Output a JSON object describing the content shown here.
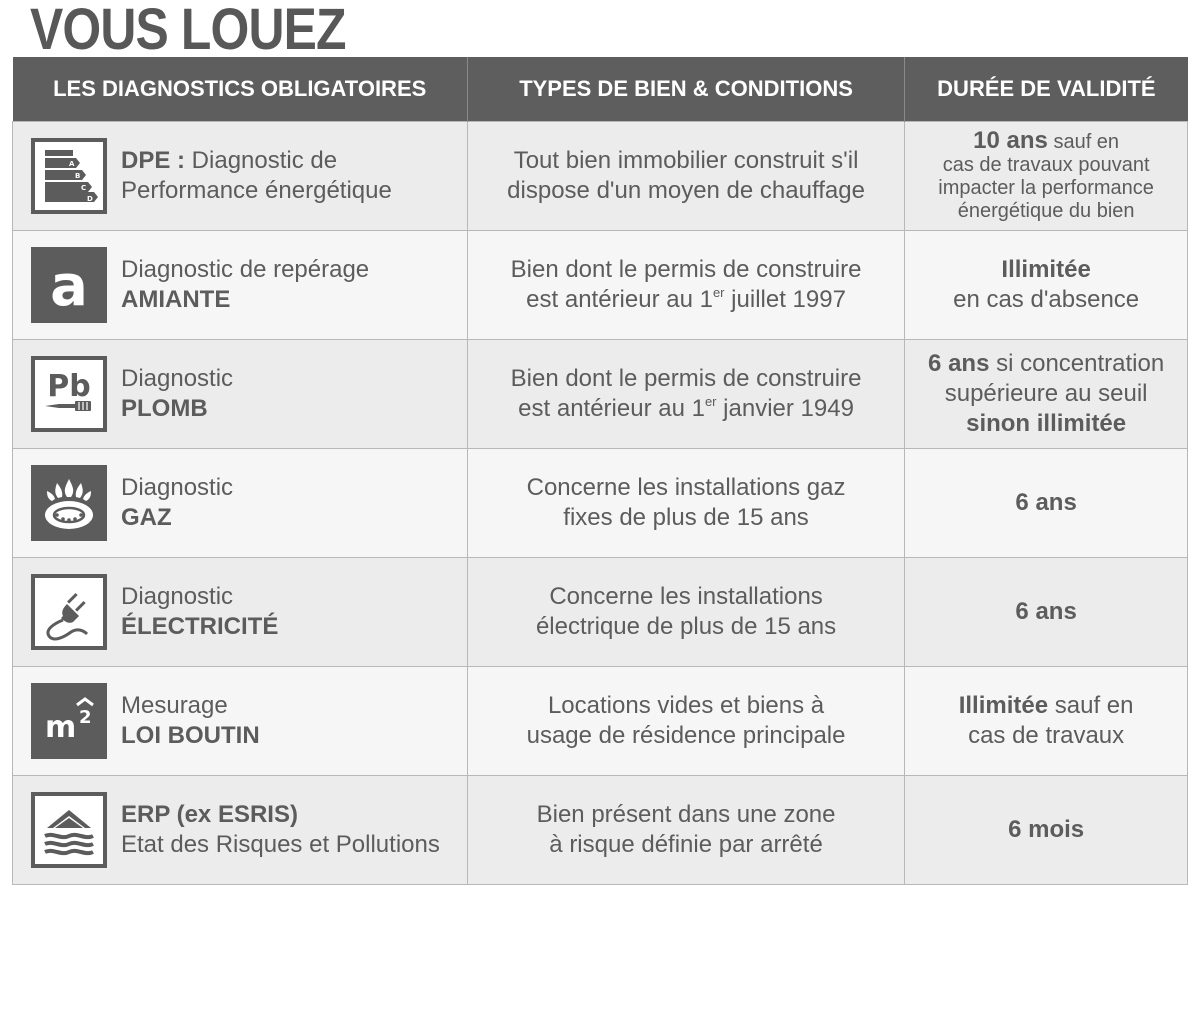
{
  "page": {
    "title": "VOUS LOUEZ"
  },
  "table": {
    "headers": [
      "LES DIAGNOSTICS OBLIGATOIRES",
      "TYPES DE BIEN & CONDITIONS",
      "DURÉE DE VALIDITÉ"
    ],
    "rows": [
      {
        "icon": "energy-rating-icon",
        "name_bold": "DPE :",
        "name_rest": " Diagnostic de",
        "name_line2": "Performance énergétique",
        "cond_line1": "Tout bien immobilier construit s'il",
        "cond_line2": "dispose d'un moyen de chauffage",
        "dur_bold": "10 ans",
        "dur_rest": " sauf en",
        "dur_line2": "cas de travaux pouvant",
        "dur_line3": "impacter la performance",
        "dur_line4": "énergétique du bien"
      },
      {
        "icon": "asbestos-icon",
        "name_line1": "Diagnostic de repérage",
        "name_bold": "AMIANTE",
        "cond_line1": "Bien dont le permis de construire",
        "cond_pre": "est antérieur au 1",
        "cond_sup": "er",
        "cond_post": " juillet 1997",
        "dur_bold": "Illimitée",
        "dur_line2": "en cas d'absence"
      },
      {
        "icon": "lead-paint-icon",
        "name_line1": "Diagnostic",
        "name_bold": "PLOMB",
        "cond_line1": "Bien dont le permis de construire",
        "cond_pre": "est antérieur au 1",
        "cond_sup": "er",
        "cond_post": " janvier 1949",
        "dur_bold": "6 ans",
        "dur_rest": " si concentration",
        "dur_line2": "supérieure au seuil",
        "dur_line3": "sinon illimitée"
      },
      {
        "icon": "gas-burner-icon",
        "name_line1": "Diagnostic",
        "name_bold": "GAZ",
        "cond_line1": "Concerne les installations gaz",
        "cond_line2": "fixes de plus de 15 ans",
        "dur_bold": "6 ans"
      },
      {
        "icon": "electric-plug-icon",
        "name_line1": "Diagnostic",
        "name_bold": "ÉLECTRICITÉ",
        "cond_line1": "Concerne les installations",
        "cond_line2": "électrique de plus de 15 ans",
        "dur_bold": "6 ans"
      },
      {
        "icon": "square-meter-icon",
        "name_line1": "Mesurage",
        "name_bold": "LOI BOUTIN",
        "cond_line1": "Locations vides et biens à",
        "cond_line2": "usage de résidence principale",
        "dur_bold": "Illimitée",
        "dur_rest": " sauf en",
        "dur_line2": "cas de travaux"
      },
      {
        "icon": "flood-risk-icon",
        "name_bold": "ERP (ex ESRIS)",
        "name_line2": "Etat des Risques et Pollutions",
        "cond_line1": "Bien présent dans une zone",
        "cond_line2": "à risque définie par arrêté",
        "dur_bold": "6 mois"
      }
    ]
  },
  "colors": {
    "header_bg": "#5e5e5e",
    "row_odd": "#ececec",
    "row_even": "#f6f6f6",
    "text": "#5c5c5c"
  }
}
